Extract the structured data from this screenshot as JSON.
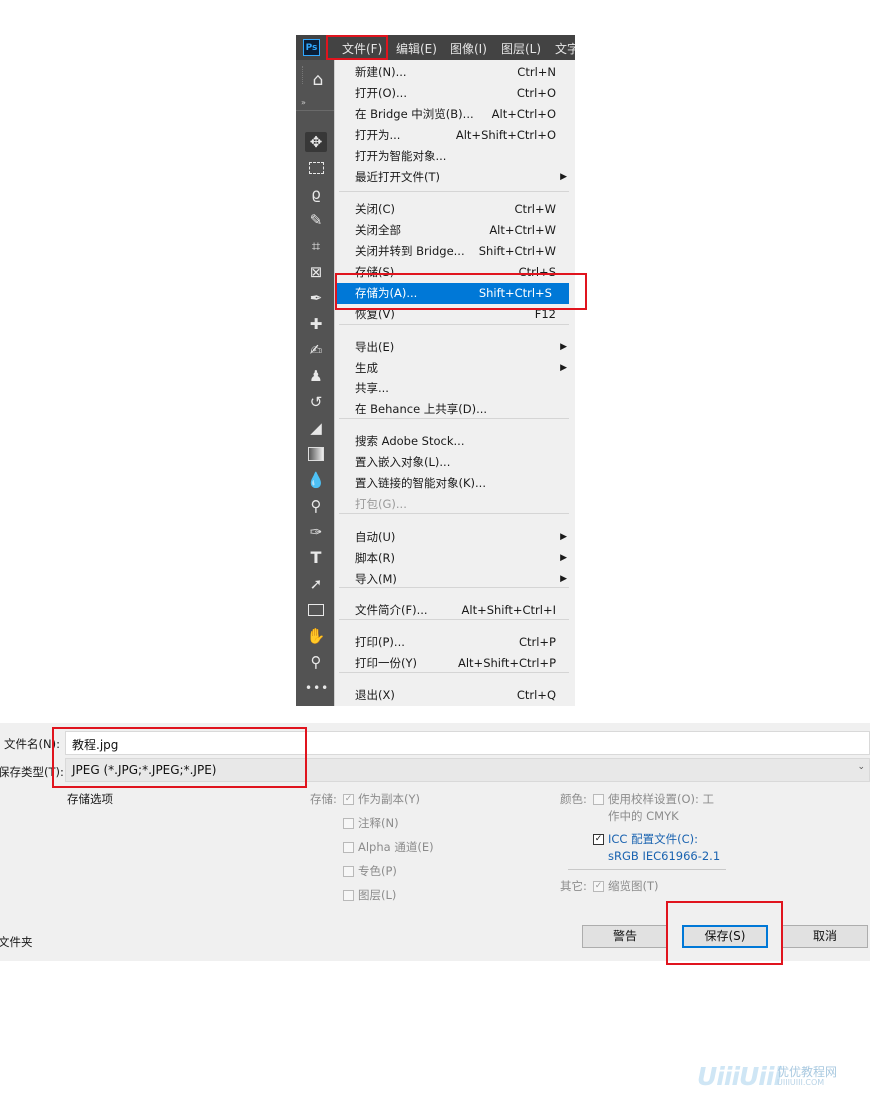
{
  "photoshop": {
    "app_icon": "Ps",
    "menubar": [
      "文件(F)",
      "编辑(E)",
      "图像(I)",
      "图层(L)",
      "文字"
    ],
    "tools": [
      "home-icon",
      "move-icon",
      "marquee-icon",
      "lasso-icon",
      "quick-select-icon",
      "crop-icon",
      "frame-icon",
      "eyedropper-icon",
      "healing-brush-icon",
      "brush-icon",
      "stamp-icon",
      "history-brush-icon",
      "eraser-icon",
      "gradient-icon",
      "blur-icon",
      "dodge-icon",
      "pen-icon",
      "type-icon",
      "path-select-icon",
      "rectangle-icon",
      "hand-icon",
      "zoom-icon",
      "more-icon"
    ],
    "file_menu": [
      {
        "label": "新建(N)...",
        "shortcut": "Ctrl+N"
      },
      {
        "label": "打开(O)...",
        "shortcut": "Ctrl+O"
      },
      {
        "label": "在 Bridge 中浏览(B)...",
        "shortcut": "Alt+Ctrl+O"
      },
      {
        "label": "打开为...",
        "shortcut": "Alt+Shift+Ctrl+O"
      },
      {
        "label": "打开为智能对象...",
        "shortcut": ""
      },
      {
        "label": "最近打开文件(T)",
        "shortcut": "",
        "submenu": true
      },
      {
        "label": "关闭(C)",
        "shortcut": "Ctrl+W"
      },
      {
        "label": "关闭全部",
        "shortcut": "Alt+Ctrl+W"
      },
      {
        "label": "关闭并转到 Bridge...",
        "shortcut": "Shift+Ctrl+W"
      },
      {
        "label": "存储(S)",
        "shortcut": "Ctrl+S"
      },
      {
        "label": "存储为(A)...",
        "shortcut": "Shift+Ctrl+S",
        "highlighted": true
      },
      {
        "label": "恢复(V)",
        "shortcut": "F12"
      },
      {
        "label": "导出(E)",
        "shortcut": "",
        "submenu": true
      },
      {
        "label": "生成",
        "shortcut": "",
        "submenu": true
      },
      {
        "label": "共享...",
        "shortcut": ""
      },
      {
        "label": "在 Behance 上共享(D)...",
        "shortcut": ""
      },
      {
        "label": "搜索 Adobe Stock...",
        "shortcut": ""
      },
      {
        "label": "置入嵌入对象(L)...",
        "shortcut": ""
      },
      {
        "label": "置入链接的智能对象(K)...",
        "shortcut": ""
      },
      {
        "label": "打包(G)...",
        "shortcut": "",
        "disabled": true
      },
      {
        "label": "自动(U)",
        "shortcut": "",
        "submenu": true
      },
      {
        "label": "脚本(R)",
        "shortcut": "",
        "submenu": true
      },
      {
        "label": "导入(M)",
        "shortcut": "",
        "submenu": true
      },
      {
        "label": "文件简介(F)...",
        "shortcut": "Alt+Shift+Ctrl+I"
      },
      {
        "label": "打印(P)...",
        "shortcut": "Ctrl+P"
      },
      {
        "label": "打印一份(Y)",
        "shortcut": "Alt+Shift+Ctrl+P"
      },
      {
        "label": "退出(X)",
        "shortcut": "Ctrl+Q"
      }
    ]
  },
  "save_dialog": {
    "filename_label": "文件名(N):",
    "filename_value": "教程.jpg",
    "filetype_label": "保存类型(T):",
    "filetype_value": "JPEG (*.JPG;*.JPEG;*.JPE)",
    "save_options_label": "存储选项",
    "storage_label": "存储:",
    "storage_options": [
      {
        "label": "作为副本(Y)",
        "checked": true,
        "enabled": false
      },
      {
        "label": "注释(N)",
        "checked": false,
        "enabled": false
      },
      {
        "label": "Alpha 通道(E)",
        "checked": false,
        "enabled": false
      },
      {
        "label": "专色(P)",
        "checked": false,
        "enabled": false
      },
      {
        "label": "图层(L)",
        "checked": false,
        "enabled": false
      }
    ],
    "color_label": "颜色:",
    "proof_setup_line1": "使用校样设置(O): 工",
    "proof_setup_line2": "作中的 CMYK",
    "icc_line1": "ICC 配置文件(C):",
    "icc_line2": "sRGB IEC61966-2.1",
    "other_label": "其它:",
    "thumbnail_label": "缩览图(T)",
    "folder_label": "文件夹",
    "buttons": {
      "warning": "警告",
      "save": "保存(S)",
      "cancel": "取消"
    }
  },
  "watermark": {
    "brand": "UiiiUiii",
    "cn": "优优教程网",
    "url": "UIIIUIII.COM"
  }
}
